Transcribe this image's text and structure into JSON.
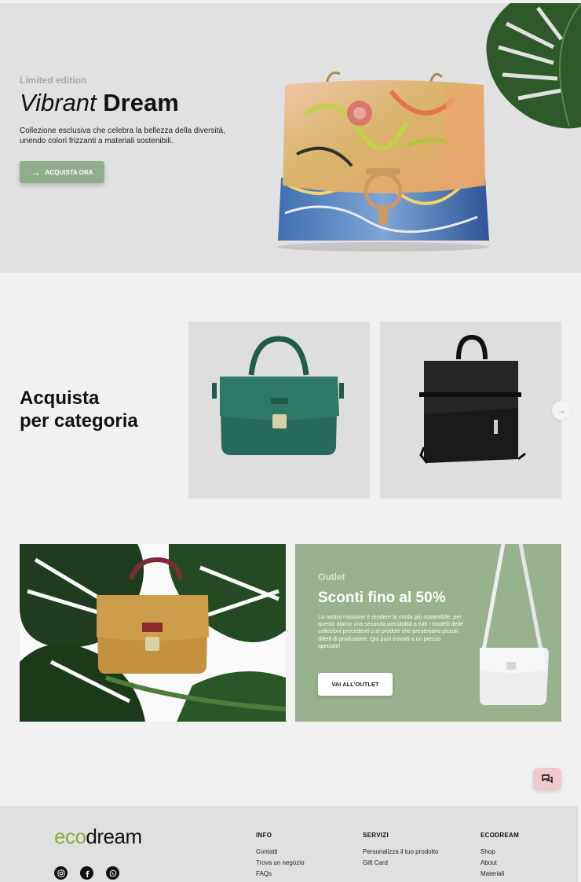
{
  "hero": {
    "eyebrow": "Limited edition",
    "title_italic": "Vibrant",
    "title_bold": "Dream",
    "description": "Collezione esclusiva che celebra la bellezza della diversità, unendo colori frizzanti a materiali sostenibili.",
    "cta_label": "ACQUISTA ORA",
    "cta_icon": "arrow-right-icon"
  },
  "categories": {
    "heading_line1": "Acquista",
    "heading_line2": "per categoria",
    "next_icon": "arrow-right-icon"
  },
  "outlet": {
    "eyebrow": "Outlet",
    "title": "Sconti fino al 50%",
    "description": "La nostra missione è rendere la moda più sostenibile, per questo diamo una seconda possibilità a tutti i modelli delle collezioni precedenti o ai prodotti che presentano piccoli difetti di produzione. Qui puoi trovarli a un prezzo speciale!",
    "button_label": "VAI ALL'OUTLET"
  },
  "chat": {
    "icon": "chat-icon"
  },
  "footer": {
    "logo_eco": "eco",
    "logo_dream": "dream",
    "socials": [
      "instagram-icon",
      "facebook-icon",
      "whatsapp-icon"
    ],
    "columns": {
      "info": {
        "title": "INFO",
        "links": [
          "Contatti",
          "Trova un negozio",
          "FAQs"
        ]
      },
      "servizi": {
        "title": "SERVIZI",
        "links": [
          "Personalizza il tuo prodotto",
          "Gift Card"
        ]
      },
      "ecodream": {
        "title": "ECODREAM",
        "links": [
          "Shop",
          "About",
          "Materiali"
        ]
      }
    }
  },
  "colors": {
    "accent_green": "#8fae8b",
    "outlet_green": "#97b28d",
    "logo_green": "#8aac3e",
    "chat_pink": "#f2c8cf"
  }
}
